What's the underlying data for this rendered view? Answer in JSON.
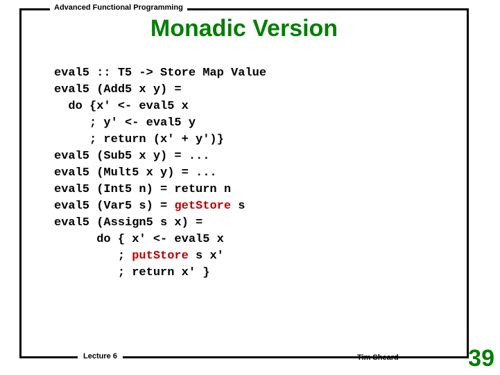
{
  "header": "Advanced Functional Programming",
  "title": "Monadic Version",
  "code": {
    "l01": "eval5 :: T5 -> Store Map Value",
    "l02": "eval5 (Add5 x y) =",
    "l03": "  do {x' <- eval5 x",
    "l04": "     ; y' <- eval5 y",
    "l05": "     ; return (x' + y')}",
    "l06": "eval5 (Sub5 x y) = ...",
    "l07": "eval5 (Mult5 x y) = ...",
    "l08": "eval5 (Int5 n) = return n",
    "l09a": "eval5 (Var5 s) = ",
    "l09b": "getStore",
    "l09c": " s",
    "l10": "eval5 (Assign5 s x) =",
    "l11": "      do { x' <- eval5 x",
    "l12a": "         ; ",
    "l12b": "putStore",
    "l12c": " s x'",
    "l13": "         ; return x' }"
  },
  "footer": {
    "lecture": "Lecture 6",
    "author": "Tim Sheard",
    "page": "39"
  }
}
